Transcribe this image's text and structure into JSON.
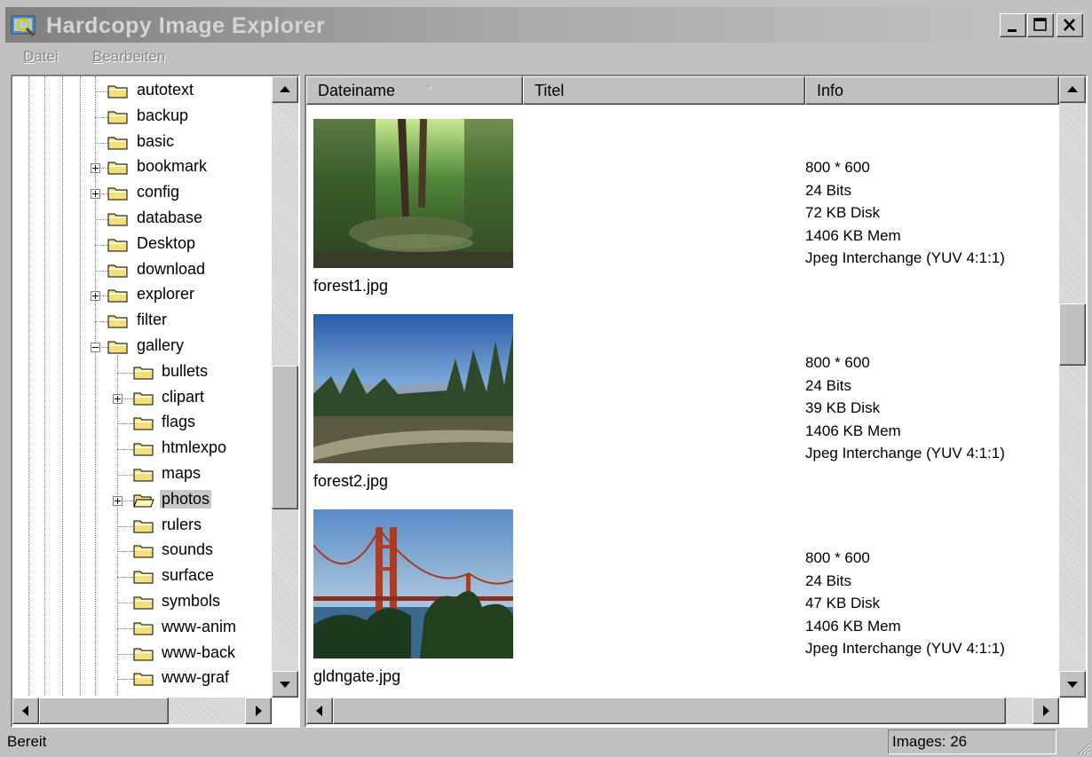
{
  "window": {
    "title": "Hardcopy Image Explorer",
    "controls": [
      "minimize",
      "maximize",
      "close"
    ]
  },
  "menu": [
    {
      "label": "Datei",
      "mnemonic": "D",
      "rest": "atei"
    },
    {
      "label": "Bearbeiten",
      "mnemonic": "B",
      "rest": "earbeiten"
    }
  ],
  "tree": {
    "items": [
      {
        "label": "autotext",
        "level": 0,
        "expander": "none"
      },
      {
        "label": "backup",
        "level": 0,
        "expander": "none"
      },
      {
        "label": "basic",
        "level": 0,
        "expander": "none"
      },
      {
        "label": "bookmark",
        "level": 0,
        "expander": "plus"
      },
      {
        "label": "config",
        "level": 0,
        "expander": "plus"
      },
      {
        "label": "database",
        "level": 0,
        "expander": "none"
      },
      {
        "label": "Desktop",
        "level": 0,
        "expander": "none"
      },
      {
        "label": "download",
        "level": 0,
        "expander": "none"
      },
      {
        "label": "explorer",
        "level": 0,
        "expander": "plus"
      },
      {
        "label": "filter",
        "level": 0,
        "expander": "none"
      },
      {
        "label": "gallery",
        "level": 0,
        "expander": "minus"
      },
      {
        "label": "bullets",
        "level": 1,
        "expander": "none"
      },
      {
        "label": "clipart",
        "level": 1,
        "expander": "plus"
      },
      {
        "label": "flags",
        "level": 1,
        "expander": "none"
      },
      {
        "label": "htmlexpo",
        "level": 1,
        "expander": "none"
      },
      {
        "label": "maps",
        "level": 1,
        "expander": "none"
      },
      {
        "label": "photos",
        "level": 1,
        "expander": "plus",
        "selected": true,
        "open": true
      },
      {
        "label": "rulers",
        "level": 1,
        "expander": "none"
      },
      {
        "label": "sounds",
        "level": 1,
        "expander": "none"
      },
      {
        "label": "surface",
        "level": 1,
        "expander": "none"
      },
      {
        "label": "symbols",
        "level": 1,
        "expander": "none"
      },
      {
        "label": "www-anim",
        "level": 1,
        "expander": "none"
      },
      {
        "label": "www-back",
        "level": 1,
        "expander": "none"
      },
      {
        "label": "www-graf",
        "level": 1,
        "expander": "none"
      }
    ]
  },
  "list": {
    "columns": [
      {
        "label": "Dateiname",
        "sort_indicator": "^"
      },
      {
        "label": "Titel"
      },
      {
        "label": "Info"
      }
    ],
    "rows": [
      {
        "filename": "forest1.jpg",
        "thumbnail": "forest",
        "info": [
          "800 * 600",
          "24 Bits",
          "72 KB Disk",
          "1406 KB Mem",
          "Jpeg Interchange (YUV 4:1:1)"
        ]
      },
      {
        "filename": "forest2.jpg",
        "thumbnail": "forest-path",
        "info": [
          "800 * 600",
          "24 Bits",
          "39 KB Disk",
          "1406 KB Mem",
          "Jpeg Interchange (YUV 4:1:1)"
        ]
      },
      {
        "filename": "gldngate.jpg",
        "thumbnail": "golden-gate-bridge",
        "info": [
          "800 * 600",
          "24 Bits",
          "47 KB Disk",
          "1406 KB Mem",
          "Jpeg Interchange (YUV 4:1:1)"
        ]
      }
    ]
  },
  "status": {
    "text": "Bereit",
    "images": "Images: 26"
  },
  "colors": {
    "face": "#c0c0c0",
    "title_bar_inactive": "#808080",
    "folder": "#f4e07a",
    "selection": "#c8c8c8"
  }
}
